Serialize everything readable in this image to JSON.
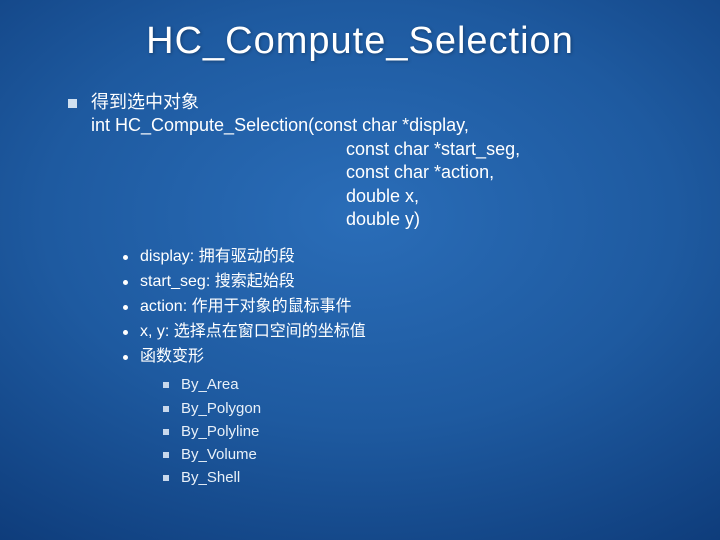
{
  "title": "HC_Compute_Selection",
  "main": {
    "desc": "得到选中对象",
    "sig_line": "int HC_Compute_Selection(const char *display,",
    "sig_params": [
      "const char *start_seg,",
      "const char *action,",
      "double x,",
      "double y)"
    ]
  },
  "params": [
    "display: 拥有驱动的段",
    "start_seg: 搜索起始段",
    "action: 作用于对象的鼠标事件",
    "x, y: 选择点在窗口空间的坐标值",
    "函数变形"
  ],
  "variants": [
    "By_Area",
    "By_Polygon",
    "By_Polyline",
    "By_Volume",
    "By_Shell"
  ]
}
